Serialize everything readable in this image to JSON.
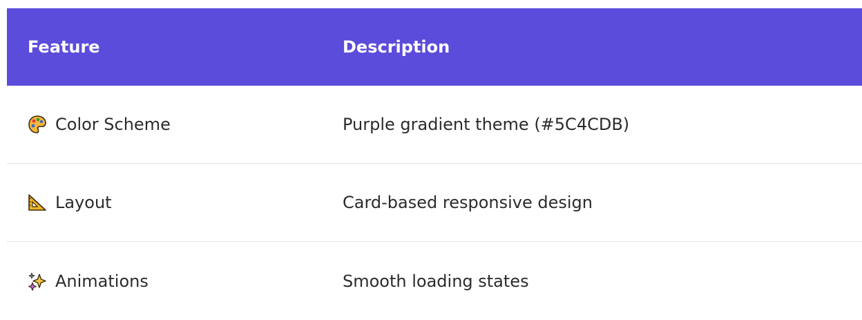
{
  "table": {
    "headers": [
      "Feature",
      "Description"
    ],
    "rows": [
      {
        "icon": "palette-icon",
        "feature": "Color Scheme",
        "description": "Purple gradient theme (#5C4CDB)"
      },
      {
        "icon": "triangle-ruler-icon",
        "feature": "Layout",
        "description": "Card-based responsive design"
      },
      {
        "icon": "sparkles-icon",
        "feature": "Animations",
        "description": "Smooth loading states"
      }
    ]
  },
  "colors": {
    "header_background": "#5C4CDB",
    "header_text": "#FFFFFF",
    "body_text": "#2B2B2B",
    "divider": "#E2E2E2"
  }
}
